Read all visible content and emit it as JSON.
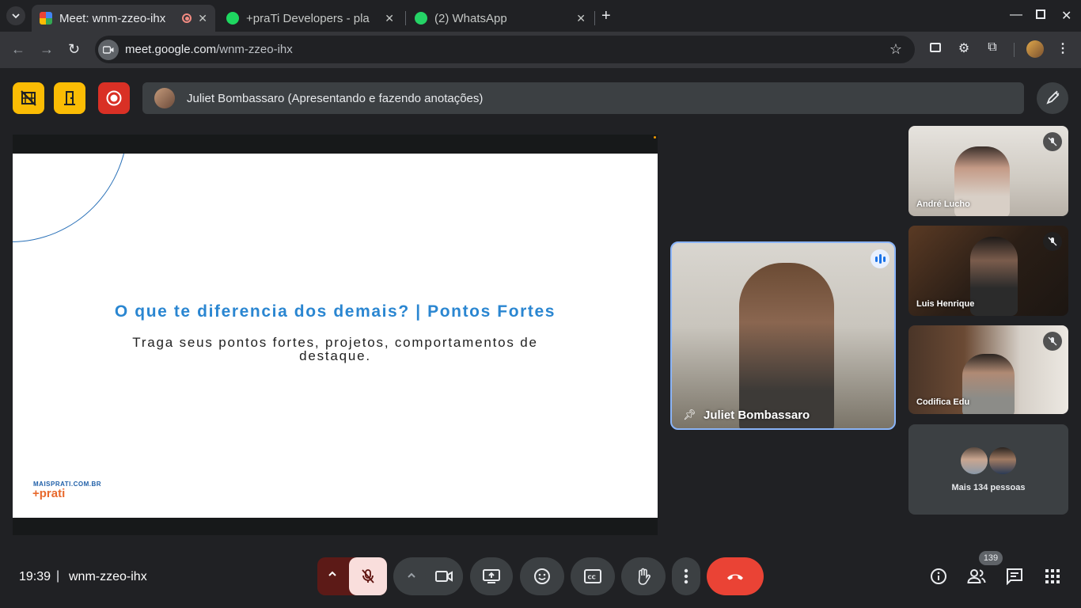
{
  "browser": {
    "tabs": [
      {
        "title": "Meet: wnm-zzeo-ihx",
        "active": true
      },
      {
        "title": "+praTi Developers - pla",
        "active": false
      },
      {
        "title": "(2) WhatsApp",
        "active": false
      }
    ],
    "url_host": "meet.google.com",
    "url_path": "/wnm-zzeo-ihx"
  },
  "presentation_bar": {
    "text": "Juliet Bombassaro (Apresentando e fazendo anotações)"
  },
  "slide": {
    "title": "O que te diferencia dos demais? | Pontos Fortes",
    "body": "Traga seus pontos fortes, projetos, comportamentos de destaque.",
    "logo_small": "MAISPRATI.COM.BR",
    "logo_main": "+prati"
  },
  "participants": {
    "main_speaker": "Juliet Bombassaro",
    "side": [
      "André Lucho",
      "Luis Henrique",
      "Codifica Edu"
    ],
    "more": "Mais 134 pessoas"
  },
  "bottom": {
    "time": "19:39",
    "separator": "|",
    "meeting_code": "wnm-zzeo-ihx",
    "participant_count": "139"
  },
  "colors": {
    "background": "#202124",
    "alert_yellow": "#fbbc04",
    "record_red": "#d93025",
    "end_call_red": "#ea4335",
    "mic_muted_bg": "#f9dedc",
    "slide_title_blue": "#2a86d1"
  }
}
